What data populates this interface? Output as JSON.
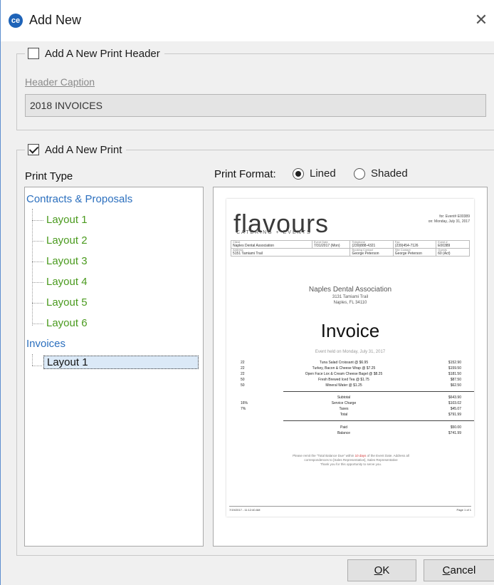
{
  "window": {
    "title": "Add New",
    "icon": "app-logo-icon",
    "close_icon": "close-icon"
  },
  "print_header_group": {
    "checkbox_label": "Add A New Print Header",
    "checked": false,
    "caption_label": "Header Caption",
    "caption_value": "2018 INVOICES"
  },
  "print_group": {
    "checkbox_label": "Add A New Print",
    "checked": true
  },
  "print_type": {
    "label": "Print Type",
    "tree": [
      {
        "label": "Contracts & Proposals",
        "children": [
          "Layout 1",
          "Layout 2",
          "Layout 3",
          "Layout 4",
          "Layout 5",
          "Layout 6"
        ]
      },
      {
        "label": "Invoices",
        "children": [
          "Layout 1"
        ]
      }
    ],
    "selected": "Invoices / Layout 1"
  },
  "print_format": {
    "label": "Print Format:",
    "options": [
      "Lined",
      "Shaded"
    ],
    "selected": "Lined"
  },
  "preview": {
    "logo": "flavours",
    "logo_sub": "CATERING + EVENTS",
    "event_info_1": "for: Event# E00389",
    "event_info_2": "on: Monday, July 31, 2017",
    "table_headers": [
      "Client",
      "Event Date",
      "Telephone",
      "Fax",
      "Event #"
    ],
    "table_values": [
      "Naples Dental Association",
      "7/31/2017 (Mon)",
      "(239)888-4321",
      "(239)454-7126",
      "E00389"
    ],
    "table_headers_2": [
      "Address",
      "",
      "Booking Contact",
      "Site Contact",
      "Guests"
    ],
    "table_values_2": [
      "5151 Tamiami Trail",
      "",
      "George Peterson",
      "George Peterson",
      "60 (Act)"
    ],
    "client_name": "Naples Dental Association",
    "client_addr1": "3131 Tamiami Trail",
    "client_addr2": "Naples, FL 34110",
    "title": "Invoice",
    "event_held": "Event held on Monday, July 31, 2017",
    "items": [
      {
        "qty": "22",
        "desc": "Tuna Salad Croissant @ $6.95",
        "amount": "$152.90"
      },
      {
        "qty": "22",
        "desc": "Turkey, Bacon & Cheese Wrap @ $7.25",
        "amount": "$159.50"
      },
      {
        "qty": "22",
        "desc": "Open Face Lox & Cream Cheese Bagel @ $8.25",
        "amount": "$181.50"
      },
      {
        "qty": "50",
        "desc": "Fresh Brewed Iced Tea @ $1.75",
        "amount": "$87.50"
      },
      {
        "qty": "50",
        "desc": "Mineral Water @ $1.25",
        "amount": "$62.50"
      }
    ],
    "totals": [
      {
        "pct": "",
        "label": "Subtotal",
        "amount": "$643.90"
      },
      {
        "pct": "16%",
        "label": "Service Charge",
        "amount": "$103.02"
      },
      {
        "pct": "7%",
        "label": "Taxes",
        "amount": "$45.07"
      },
      {
        "pct": "",
        "label": "Total",
        "amount": "$791.99"
      }
    ],
    "paid": {
      "label": "Paid",
      "amount": "$50.00"
    },
    "balance": {
      "label": "Balance",
      "amount": "$741.99"
    },
    "note_1": "Please remit the \"Total Balance Due\" within",
    "note_red": "10 days",
    "note_2": "of the Event Date. Address all",
    "note_3": "correspondences to [Sales Representative], Sales Representative",
    "note_4": "Thank you for this opportunity to serve you.",
    "foot_left": "7/19/2017 - 11:12:40 AM",
    "foot_right": "Page 1 of 1"
  },
  "buttons": {
    "ok_u": "O",
    "ok_rest": "K",
    "cancel_u": "C",
    "cancel_rest": "ancel"
  }
}
